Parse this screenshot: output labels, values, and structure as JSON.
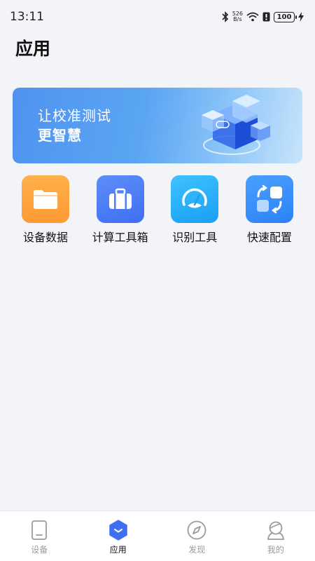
{
  "status_bar": {
    "time": "13:11",
    "net_speed_value": "526",
    "net_speed_unit": "B/s",
    "battery": "100"
  },
  "page": {
    "title": "应用"
  },
  "banner": {
    "line1": "让校准测试",
    "line2": "更智慧"
  },
  "apps": [
    {
      "label": "设备数据",
      "icon": "folder-icon",
      "color": "#ffa33f"
    },
    {
      "label": "计算工具箱",
      "icon": "toolbox-icon",
      "color": "#4d7ff6"
    },
    {
      "label": "识别工具",
      "icon": "gauge-icon",
      "color": "#28b0fa"
    },
    {
      "label": "快速配置",
      "icon": "quick-config-icon",
      "color": "#3a8ff8"
    }
  ],
  "nav": {
    "items": [
      {
        "label": "设备",
        "icon": "device-icon"
      },
      {
        "label": "应用",
        "icon": "apps-icon",
        "active": true
      },
      {
        "label": "发现",
        "icon": "compass-icon"
      },
      {
        "label": "我的",
        "icon": "profile-icon"
      }
    ]
  },
  "colors": {
    "accent": "#3f6ff2",
    "background": "#f3f4f8"
  }
}
